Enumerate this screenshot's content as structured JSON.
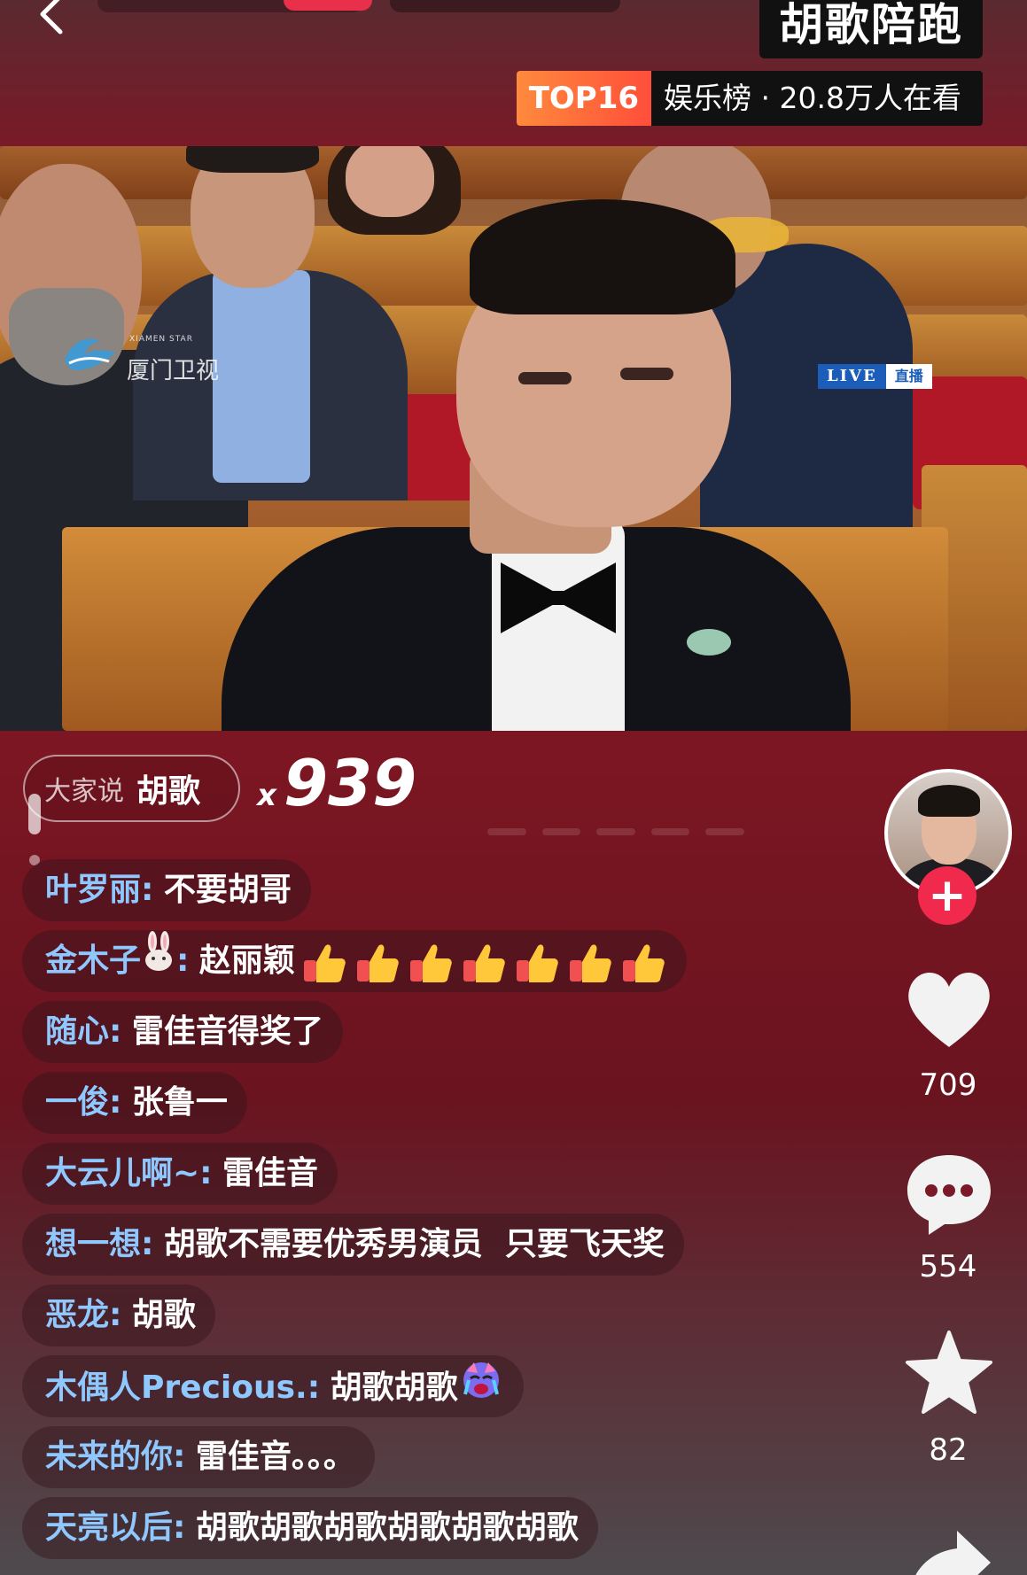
{
  "header": {
    "channel_title": "胡歌陪跑",
    "rank_badge": "TOP16",
    "rank_text": "娱乐榜 · 20.8万人在看"
  },
  "video": {
    "watermark_cn": "厦门卫视",
    "watermark_en": "XIAMEN STAR",
    "live_en": "LIVE",
    "live_cn": "直播"
  },
  "danmu_summary": {
    "label": "大家说",
    "keyword": "胡歌",
    "count_prefix": "x",
    "count": "939"
  },
  "comments": [
    {
      "user": "叶罗丽:",
      "msg": "不要胡哥"
    },
    {
      "user": "金木子",
      "user_emoji": "rabbit",
      "user_suffix": ":",
      "msg": "赵丽颖",
      "thumbs": 7
    },
    {
      "user": "随心:",
      "msg": "雷佳音得奖了"
    },
    {
      "user": "一俊:",
      "msg": "张鲁一"
    },
    {
      "user": "大云儿啊~:",
      "msg": "雷佳音"
    },
    {
      "user": "想一想:",
      "msg": "胡歌不需要优秀男演员  只要飞天奖"
    },
    {
      "user": "恶龙:",
      "msg": "胡歌"
    },
    {
      "user": "木偶人Precious.:",
      "msg": "胡歌胡歌",
      "msg_emoji": "crying-face"
    },
    {
      "user": "未来的你:",
      "msg": "雷佳音。。。"
    },
    {
      "user": "天亮以后:",
      "msg": "胡歌胡歌胡歌胡歌胡歌胡歌"
    }
  ],
  "rail": {
    "likes": "709",
    "comments": "554",
    "favorites": "82",
    "follow_symbol": "+"
  },
  "colors": {
    "username": "#8fc8ff",
    "follow": "#f0294d",
    "rank_badge": "#ff6a3c",
    "live_blue": "#1b5db8"
  }
}
